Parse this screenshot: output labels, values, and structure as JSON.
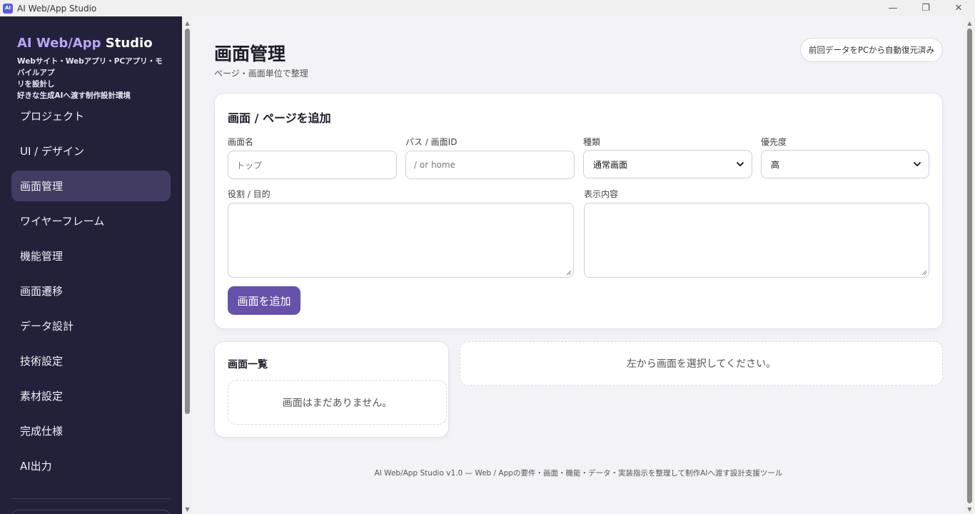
{
  "window": {
    "title": "AI Web/App Studio",
    "icon_text": "AI",
    "minimize_glyph": "—",
    "maximize_glyph": "❐",
    "close_glyph": "✕"
  },
  "sidebar": {
    "brand_prefix": "AI Web/App",
    "brand_suffix": " Studio",
    "description": "Webサイト・Webアプリ・PCアプリ・モバイルアプリを設計し好きな生成AIへ渡す制作設計環境",
    "description_line1": "Webサイト・Webアプリ・PCアプリ・モバイルアプ",
    "description_line2": "リを設計し",
    "description_line3": "好きな生成AIへ渡す制作設計環境",
    "items": [
      {
        "label": "プロジェクト",
        "active": false
      },
      {
        "label": "UI / デザイン",
        "active": false
      },
      {
        "label": "画面管理",
        "active": true
      },
      {
        "label": "ワイヤーフレーム",
        "active": false
      },
      {
        "label": "機能管理",
        "active": false
      },
      {
        "label": "画面遷移",
        "active": false
      },
      {
        "label": "データ設計",
        "active": false
      },
      {
        "label": "技術設定",
        "active": false
      },
      {
        "label": "素材設定",
        "active": false
      },
      {
        "label": "完成仕様",
        "active": false
      },
      {
        "label": "AI出力",
        "active": false
      }
    ]
  },
  "header": {
    "title": "画面管理",
    "subtitle": "ページ・画面単位で整理",
    "restore_status": "前回データをPCから自動復元済み"
  },
  "add_form": {
    "title": "画面 / ページを追加",
    "name_label": "画面名",
    "name_placeholder": "トップ",
    "path_label": "パス / 画面ID",
    "path_placeholder": "/ or home",
    "type_label": "種類",
    "type_value": "通常画面",
    "priority_label": "優先度",
    "priority_value": "高",
    "role_label": "役割 / 目的",
    "content_label": "表示内容",
    "submit_label": "画面を追加"
  },
  "screen_list": {
    "title": "画面一覧",
    "empty_text": "画面はまだありません。"
  },
  "detail": {
    "empty_text": "左から画面を選択してください。"
  },
  "footer": {
    "text": "AI Web/App Studio v1.0 — Web / Appの要件・画面・機能・データ・実装指示を整理して制作AIへ渡す設計支援ツール"
  },
  "colors": {
    "sidebar_bg": "#23213a",
    "sidebar_active": "#423c63",
    "brand_accent": "#b9a4f5",
    "primary": "#6652a8",
    "page_bg": "#f3f3f7"
  }
}
